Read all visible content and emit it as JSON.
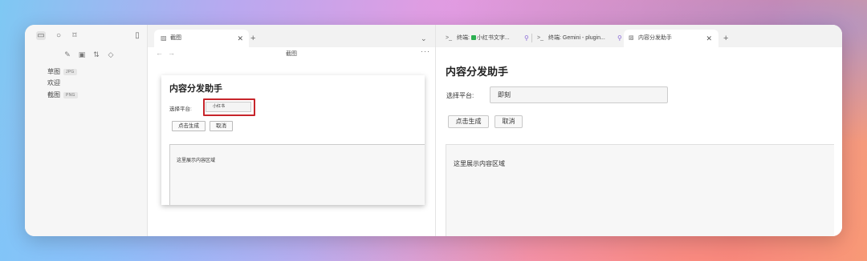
{
  "sidebar": {
    "files": [
      {
        "name": "草图",
        "badge": "JPG"
      },
      {
        "name": "欢迎",
        "badge": ""
      },
      {
        "name": "截图",
        "badge": "PNG"
      }
    ]
  },
  "middle_pane": {
    "tab_title": "截图",
    "view_title": "截图",
    "screenshot": {
      "title": "内容分发助手",
      "platform_label": "选择平台:",
      "platform_value": "小红书",
      "generate_label": "点击生成",
      "cancel_label": "取消",
      "content_placeholder": "这里展示内容区域"
    }
  },
  "right_pane": {
    "tabs": [
      {
        "title": "终端: ",
        "suffix": "小红书文字...",
        "icon": "terminal-icon"
      },
      {
        "title": "终端: Gemini - plugin...",
        "icon": "terminal-icon"
      },
      {
        "title": "内容分发助手",
        "icon": "image-icon"
      }
    ],
    "app": {
      "title": "内容分发助手",
      "platform_label": "选择平台:",
      "platform_value": "即刻",
      "generate_label": "点击生成",
      "cancel_label": "取消",
      "content_placeholder": "这里展示内容区域"
    }
  },
  "colors": {
    "highlight_border": "#c7252b",
    "pin_color": "#8a6bd8",
    "terminal_badge": "#2db052"
  }
}
